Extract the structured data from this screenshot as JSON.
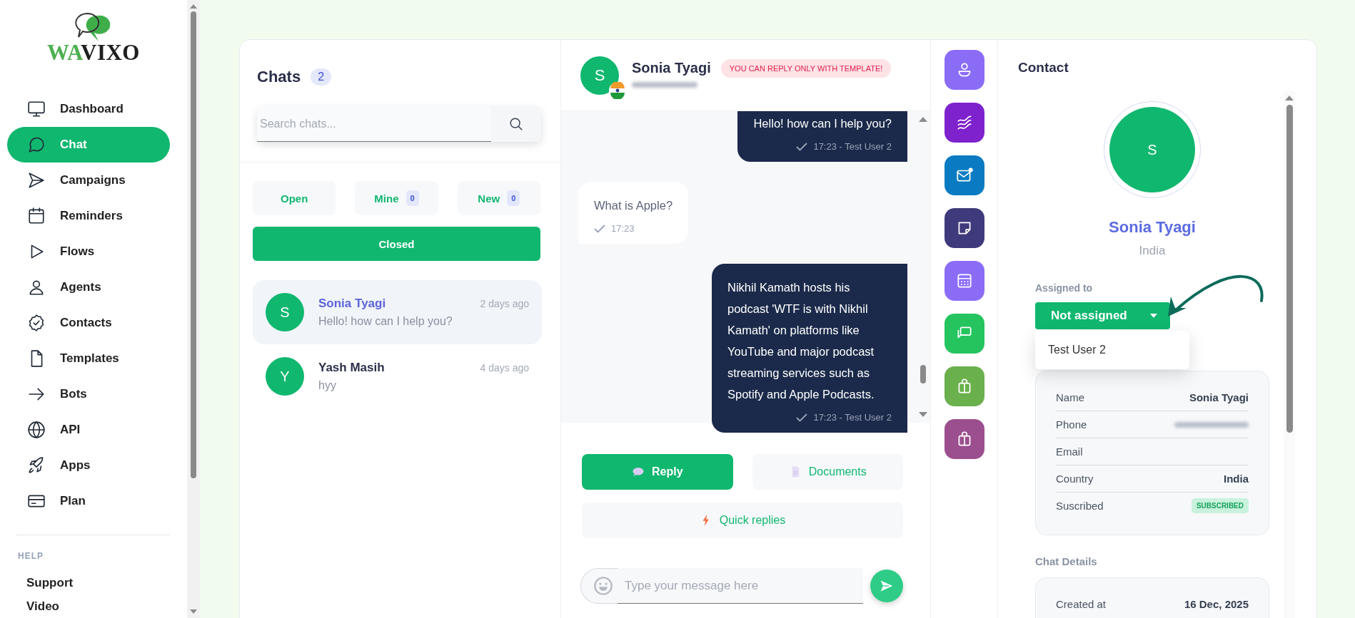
{
  "sidebar": {
    "logo": {
      "accent": "WA",
      "rest": "VIXO"
    },
    "nav": [
      {
        "label": "Dashboard",
        "selected": false
      },
      {
        "label": "Chat",
        "selected": true
      },
      {
        "label": "Campaigns",
        "selected": false
      },
      {
        "label": "Reminders",
        "selected": false
      },
      {
        "label": "Flows",
        "selected": false
      },
      {
        "label": "Agents",
        "selected": false
      },
      {
        "label": "Contacts",
        "selected": false
      },
      {
        "label": "Templates",
        "selected": false
      },
      {
        "label": "Bots",
        "selected": false
      },
      {
        "label": "API",
        "selected": false
      },
      {
        "label": "Apps",
        "selected": false
      },
      {
        "label": "Plan",
        "selected": false
      }
    ],
    "help": {
      "heading": "HELP",
      "items": [
        {
          "label": "Support"
        },
        {
          "label": "Video"
        }
      ]
    }
  },
  "chats": {
    "title": "Chats",
    "count": "2",
    "search": {
      "placeholder": "Search chats..."
    },
    "filters": [
      {
        "label": "Open",
        "selected": false
      },
      {
        "label": "Mine",
        "count": "0",
        "selected": false
      },
      {
        "label": "New",
        "count": "0",
        "selected": false
      },
      {
        "label": "Closed",
        "selected": true
      }
    ],
    "items": [
      {
        "initial": "S",
        "name": "Sonia Tyagi",
        "time": "2 days ago",
        "preview": "Hello! how can I help you?",
        "selected": true
      },
      {
        "initial": "Y",
        "name": "Yash Masih",
        "time": "4 days ago",
        "preview": "hyy",
        "selected": false
      }
    ]
  },
  "conversation": {
    "header": {
      "initial": "S",
      "name": "Sonia Tyagi",
      "notice": "YOU CAN REPLY ONLY WITH TEMPLATE!"
    },
    "messages": [
      {
        "kind": "outgoing",
        "text": "Hello! how can I help you?",
        "meta": "17:23 - Test User 2"
      },
      {
        "kind": "incoming",
        "text": "What is Apple?",
        "meta": "17:23"
      },
      {
        "kind": "outgoing",
        "text": "Nikhil Kamath hosts his podcast 'WTF is with Nikhil Kamath' on platforms like YouTube and major podcast streaming services such as Spotify and Apple Podcasts.",
        "meta": "17:23 - Test User 2"
      }
    ],
    "actions": [
      {
        "label": "Reply",
        "selected": true
      },
      {
        "label": "Documents",
        "selected": false
      },
      {
        "label": "Quick replies",
        "selected": false
      }
    ],
    "composer": {
      "placeholder": "Type your message here"
    }
  },
  "tools": [
    {
      "color": "#8b6cf7"
    },
    {
      "color": "#7e22ce"
    },
    {
      "color": "#0a7bc2"
    },
    {
      "color": "#3f3a7c"
    },
    {
      "color": "#8b6cf7"
    },
    {
      "color": "#25c45f"
    },
    {
      "color": "#6ab04c"
    },
    {
      "color": "#9b4f8f"
    }
  ],
  "contact": {
    "title": "Contact",
    "initial": "S",
    "name": "Sonia Tyagi",
    "country": "India",
    "assigned": {
      "label": "Assigned to",
      "value": "Not assigned",
      "expanded": true,
      "options": [
        "Test User 2"
      ]
    },
    "details": [
      {
        "label": "Name",
        "kind": "text",
        "value": "Sonia Tyagi"
      },
      {
        "label": "Phone",
        "kind": "redacted"
      },
      {
        "label": "Email"
      },
      {
        "label": "Country",
        "kind": "text",
        "value": "India"
      },
      {
        "label": "Suscribed",
        "kind": "badge",
        "value": "SUBSCRIBED"
      }
    ],
    "chat_details": {
      "title": "Chat Details",
      "rows": [
        {
          "label": "Created at",
          "value": "16 Dec, 2025"
        }
      ]
    }
  }
}
